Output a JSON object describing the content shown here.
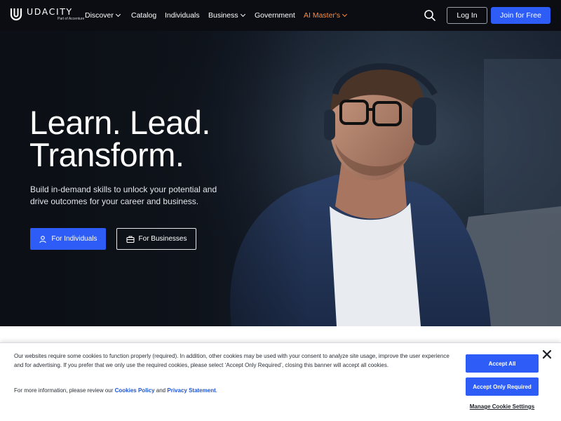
{
  "nav": {
    "logo": {
      "name": "UDACITY",
      "tagline": "Part of Accenture"
    },
    "items": [
      {
        "label": "Discover",
        "dropdown": true
      },
      {
        "label": "Catalog",
        "dropdown": false
      },
      {
        "label": "Individuals",
        "dropdown": false
      },
      {
        "label": "Business",
        "dropdown": true
      },
      {
        "label": "Government",
        "dropdown": false
      },
      {
        "label": "AI Master's",
        "dropdown": true
      }
    ],
    "login_label": "Log In",
    "join_label": "Join for Free",
    "accent_color": "#ff8a3d",
    "primary_color": "#2d5cf6"
  },
  "hero": {
    "title_line1": "Learn. Lead.",
    "title_line2": "Transform.",
    "subtitle": "Build in-demand skills to unlock your potential and drive outcomes for your career and business.",
    "cta_individuals": "For Individuals",
    "cta_businesses": "For Businesses"
  },
  "cookie": {
    "text": "Our websites require some cookies to function properly (required). In addition, other cookies may be used with your consent to analyze site usage, improve the user experience and for advertising. If you prefer that we only use the required cookies, please select ‘Accept Only Required’, closing this banner will accept all cookies.",
    "review_prefix": "For more information, please review our",
    "cookies_policy": "Cookies Policy",
    "and": "and",
    "privacy_statement": "Privacy Statement",
    "period": ".",
    "accept_all": "Accept All",
    "accept_required": "Accept Only Required",
    "manage": "Manage Cookie Settings"
  }
}
